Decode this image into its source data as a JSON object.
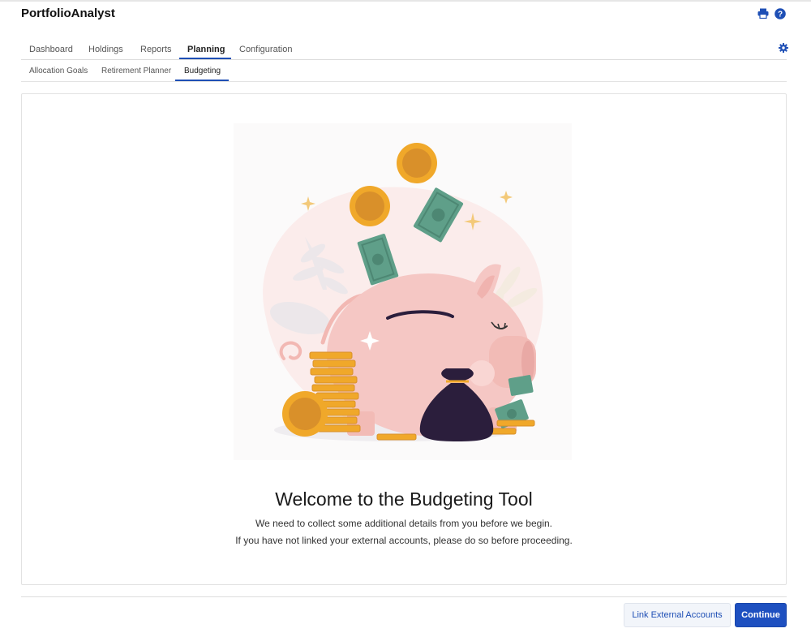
{
  "app": {
    "title": "PortfolioAnalyst"
  },
  "header_icons": {
    "print": "print-icon",
    "help": "help-icon",
    "settings": "gear-icon"
  },
  "tabs": [
    {
      "label": "Dashboard",
      "active": false
    },
    {
      "label": "Holdings",
      "active": false
    },
    {
      "label": "Reports",
      "active": false
    },
    {
      "label": "Planning",
      "active": true
    },
    {
      "label": "Configuration",
      "active": false
    }
  ],
  "subtabs": [
    {
      "label": "Allocation Goals",
      "active": false
    },
    {
      "label": "Retirement Planner",
      "active": false
    },
    {
      "label": "Budgeting",
      "active": true
    }
  ],
  "main": {
    "illustration": "piggy-bank-illustration",
    "title": "Welcome to the Budgeting Tool",
    "line1": "We need to collect some additional details from you before we begin.",
    "line2": "If you have not linked your external accounts, please do so before proceeding."
  },
  "footer": {
    "link_accounts_label": "Link External Accounts",
    "continue_label": "Continue"
  },
  "colors": {
    "accent": "#1e4fb5",
    "primary_button": "#1e50c0",
    "coin": "#f0a82a",
    "piggy": "#f5c7c4",
    "money": "#5f9f89",
    "bag": "#2b1e3c"
  }
}
